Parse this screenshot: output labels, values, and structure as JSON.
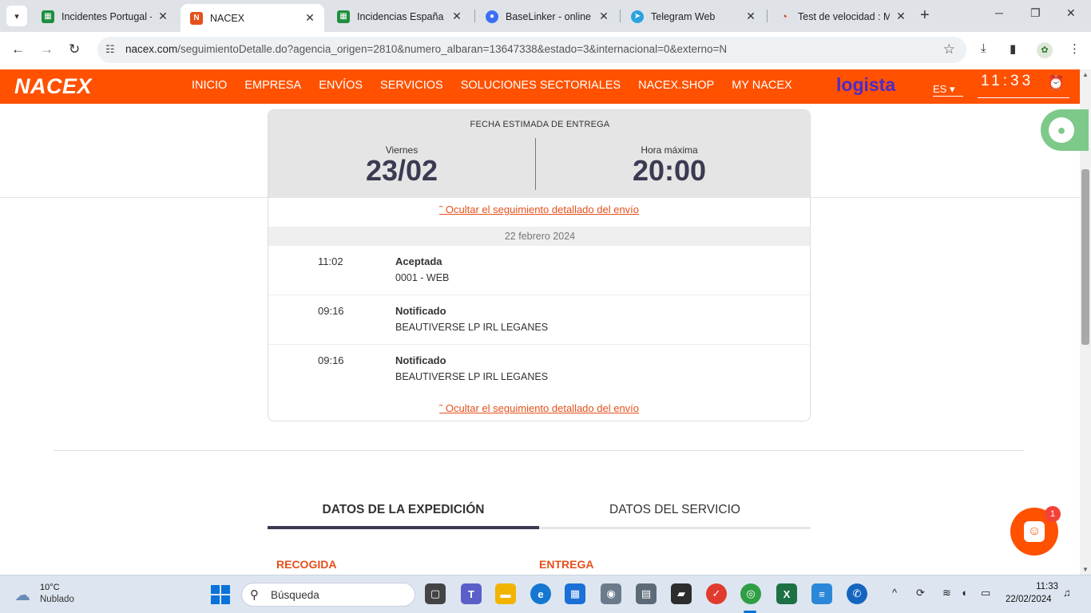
{
  "browser": {
    "tabs": [
      {
        "title": "Incidentes Portugal -",
        "icon": "sheets-icon",
        "color": "#1e8e3e"
      },
      {
        "title": "NACEX",
        "icon": "nacex-icon",
        "color": "#e5501b"
      },
      {
        "title": "Incidencias España - I",
        "icon": "sheets-icon",
        "color": "#1e8e3e"
      },
      {
        "title": "BaseLinker - online sa",
        "icon": "baselinker-icon",
        "color": "#3d6ef6"
      },
      {
        "title": "Telegram Web",
        "icon": "telegram-icon",
        "color": "#2aa3df"
      },
      {
        "title": "Test de velocidad : M",
        "icon": "speedtest-icon",
        "color": "#d93025"
      }
    ],
    "url_domain": "nacex.com",
    "url_path": "/seguimientoDetalle.do?agencia_origen=2810&numero_albaran=13647338&estado=3&internacional=0&externo=N"
  },
  "header": {
    "logo": "NACEX",
    "menu": [
      "INICIO",
      "EMPRESA",
      "ENVÍOS",
      "SERVICIOS",
      "SOLUCIONES SECTORIALES",
      "NACEX.SHOP",
      "MY NACEX"
    ],
    "partner": "logista",
    "lang": "ES",
    "clock": "11:33",
    "brand_color": "#ff5100"
  },
  "estimate": {
    "title": "FECHA ESTIMADA DE ENTREGA",
    "day_label": "Viernes",
    "date": "23/02",
    "hour_label": "Hora máxima",
    "hour": "20:00"
  },
  "tracking": {
    "toggle_label": "Ocultar el seguimiento detallado del envío",
    "date_header": "22 febrero 2024",
    "events": [
      {
        "time": "11:02",
        "status": "Aceptada",
        "detail": "0001 - WEB"
      },
      {
        "time": "09:16",
        "status": "Notificado",
        "detail": "BEAUTIVERSE LP IRL LEGANES"
      },
      {
        "time": "09:16",
        "status": "Notificado",
        "detail": "BEAUTIVERSE LP IRL LEGANES"
      }
    ]
  },
  "section_tabs": [
    "DATOS DE LA EXPEDICIÓN",
    "DATOS DEL SERVICIO"
  ],
  "section_heads": [
    "RECOGIDA",
    "ENTREGA"
  ],
  "chat_badge": "1",
  "taskbar": {
    "weather_temp": "10°C",
    "weather_desc": "Nublado",
    "search_placeholder": "Búsqueda",
    "time": "11:33",
    "date": "22/02/2024"
  }
}
